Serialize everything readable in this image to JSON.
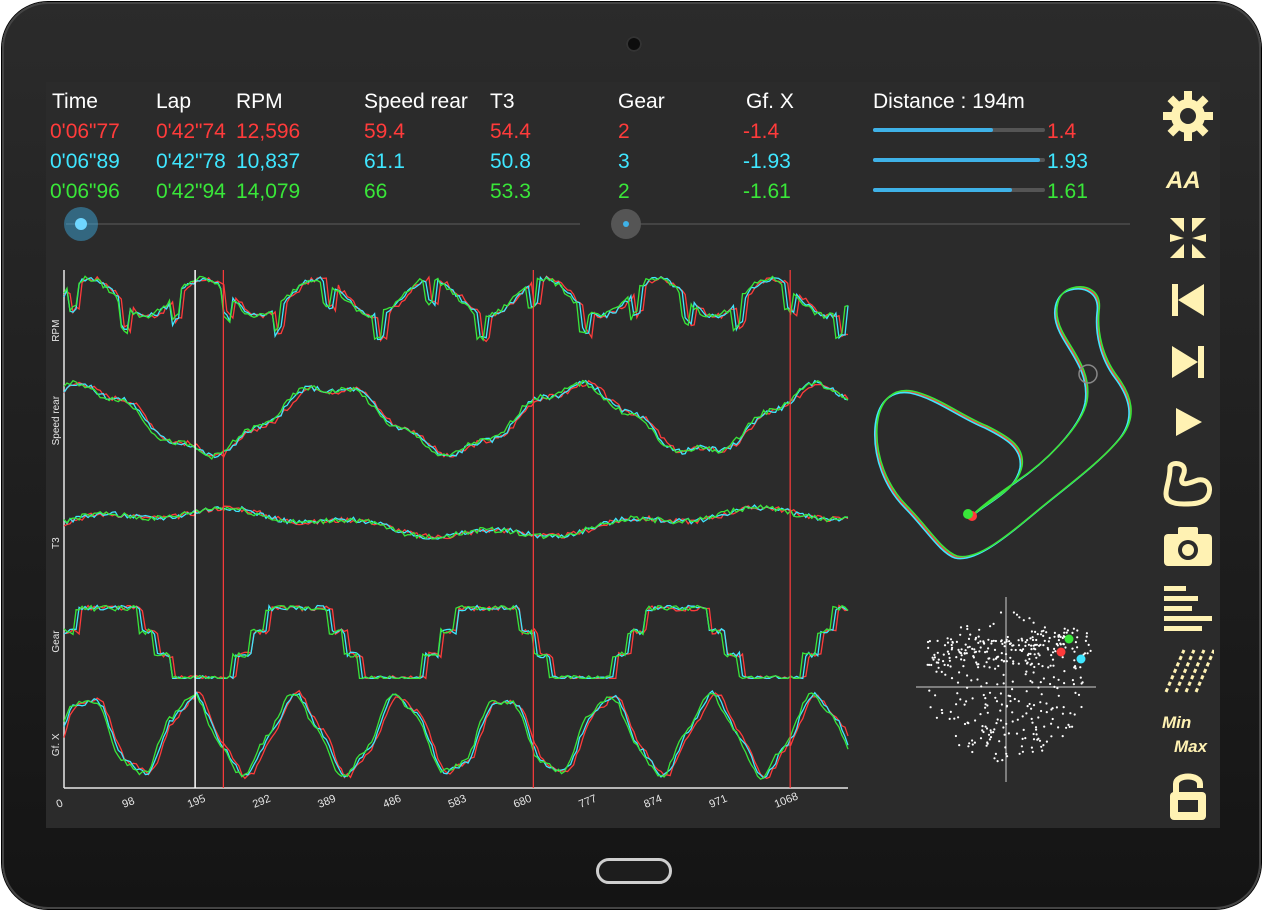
{
  "header": {
    "time": "Time",
    "lap": "Lap",
    "rpm": "RPM",
    "speed": "Speed rear",
    "t3": "T3",
    "gear": "Gear",
    "gfx": "Gf. X",
    "distance": "Distance : 194m"
  },
  "rows": [
    {
      "time": "0'06\"77",
      "lap": "0'42\"74",
      "rpm": "12,596",
      "speed": "59.4",
      "t3": "54.4",
      "gear": "2",
      "gfx": "-1.4",
      "bar": "1.4",
      "fill": 0.7,
      "color": "#ff3b3b"
    },
    {
      "time": "0'06\"89",
      "lap": "0'42\"78",
      "rpm": "10,837",
      "speed": "61.1",
      "t3": "50.8",
      "gear": "3",
      "gfx": "-1.93",
      "bar": "1.93",
      "fill": 0.97,
      "color": "#3fe6ff"
    },
    {
      "time": "0'06\"96",
      "lap": "0'42\"94",
      "rpm": "14,079",
      "speed": "66",
      "t3": "53.3",
      "gear": "2",
      "gfx": "-1.61",
      "bar": "1.61",
      "fill": 0.81,
      "color": "#39e639"
    }
  ],
  "sliders": {
    "left_value": 0.03,
    "right_value": 0.02
  },
  "chart_data": {
    "type": "line",
    "x_ticks": [
      "0",
      "98",
      "195",
      "292",
      "389",
      "486",
      "583",
      "680",
      "777",
      "874",
      "971",
      "1068"
    ],
    "channels": [
      "RPM",
      "Speed rear",
      "T3",
      "Gear",
      "Gf. X"
    ],
    "cursor_x": 195,
    "markers_x": [
      237,
      698,
      1080
    ],
    "series_colors": [
      "#ff3b3b",
      "#3fe6ff",
      "#39e639"
    ]
  },
  "sidebar": {
    "icons": [
      "gear-icon",
      "font-size-icon",
      "expand-icon",
      "skip-back-icon",
      "skip-forward-icon",
      "play-icon",
      "track-icon",
      "camera-icon",
      "bars-icon",
      "stripes-icon",
      "minmax-icon",
      "unlock-icon"
    ],
    "min_label": "Min",
    "max_label": "Max",
    "font_label": "AA",
    "accent": "#fff2b3"
  }
}
